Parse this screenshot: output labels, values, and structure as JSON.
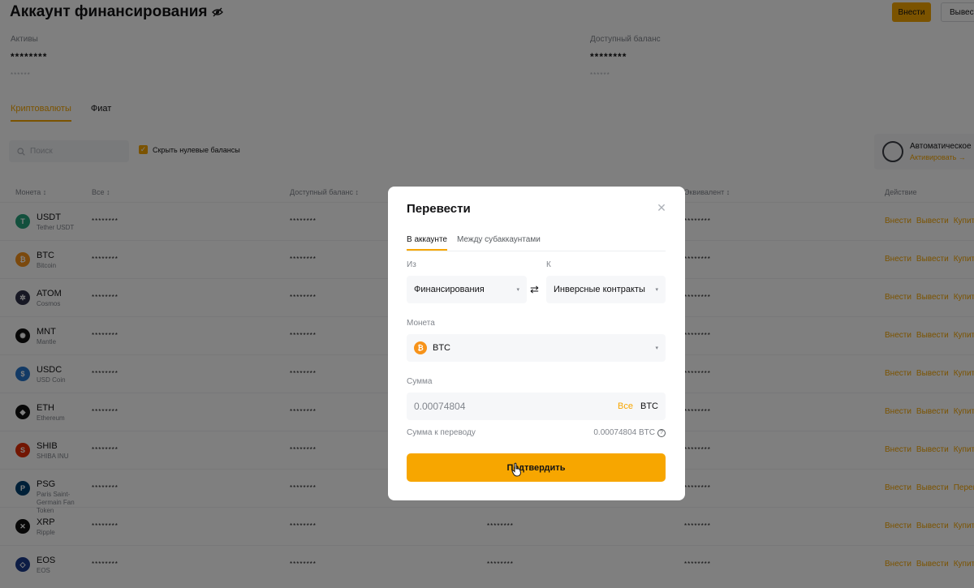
{
  "header": {
    "title": "Аккаунт финансирования",
    "deposit_label": "Внести",
    "withdraw_label": "Вывести"
  },
  "balances": {
    "assets_label": "Активы",
    "assets_value": "********",
    "assets_sub": "******",
    "available_label": "Доступный баланс",
    "available_value": "********",
    "available_sub": "******"
  },
  "page_tabs": [
    "Криптовалюты",
    "Фиат"
  ],
  "filters": {
    "search_placeholder": "Поиск",
    "hide_zero_label": "Скрыть нулевые балансы"
  },
  "auto_card": {
    "title": "Автоматическое",
    "link": "Активировать →"
  },
  "table": {
    "headers": [
      "Монета ↕",
      "Все ↕",
      "Доступный баланс ↕",
      "Эквивалент ↕",
      "Действие"
    ],
    "masked": "********",
    "rows": [
      {
        "symbol": "USDT",
        "name": "Tether USDT",
        "color": "#26a17b",
        "glyph": "T",
        "actions": [
          "Внести",
          "Вывести",
          "Купить"
        ]
      },
      {
        "symbol": "BTC",
        "name": "Bitcoin",
        "color": "#f7931a",
        "glyph": "₿",
        "actions": [
          "Внести",
          "Вывести",
          "Купить"
        ]
      },
      {
        "symbol": "ATOM",
        "name": "Cosmos",
        "color": "#2e3148",
        "glyph": "✲",
        "actions": [
          "Внести",
          "Вывести",
          "Купить"
        ]
      },
      {
        "symbol": "MNT",
        "name": "Mantle",
        "color": "#111111",
        "glyph": "✺",
        "actions": [
          "Внести",
          "Вывести",
          "Купить"
        ]
      },
      {
        "symbol": "USDC",
        "name": "USD Coin",
        "color": "#2775ca",
        "glyph": "$",
        "actions": [
          "Внести",
          "Вывести",
          "Купить"
        ]
      },
      {
        "symbol": "ETH",
        "name": "Ethereum",
        "color": "#111111",
        "glyph": "◆",
        "actions": [
          "Внести",
          "Вывести",
          "Купить"
        ]
      },
      {
        "symbol": "SHIB",
        "name": "SHIBA INU",
        "color": "#e42d04",
        "glyph": "S",
        "actions": [
          "Внести",
          "Вывести",
          "Купить"
        ]
      },
      {
        "symbol": "PSG",
        "name": "Paris Saint-Germain Fan Token",
        "color": "#004170",
        "glyph": "P",
        "actions": [
          "Внести",
          "Вывести",
          "Перевести"
        ]
      },
      {
        "symbol": "XRP",
        "name": "Ripple",
        "color": "#111111",
        "glyph": "✕",
        "actions": [
          "Внести",
          "Вывести",
          "Купить"
        ]
      },
      {
        "symbol": "EOS",
        "name": "EOS",
        "color": "#1a3a8a",
        "glyph": "◇",
        "actions": [
          "Внести",
          "Вывести",
          "Купить"
        ]
      }
    ]
  },
  "modal": {
    "title": "Перевести",
    "tabs": [
      "В аккаунте",
      "Между субаккаунтами"
    ],
    "from_label": "Из",
    "from_value": "Финансирования",
    "to_label": "К",
    "to_value": "Инверсные контракты",
    "coin_label": "Монета",
    "coin_value": "BTC",
    "amount_label": "Сумма",
    "amount_value": "0.00074804",
    "all_label": "Все",
    "amount_unit": "BTC",
    "transfer_sum_label": "Сумма к переводу",
    "transfer_sum_value": "0.00074804 BTC",
    "confirm_label": "Подтвердить"
  },
  "colors": {
    "accent": "#f7a600",
    "overlay": "rgba(0,0,0,0.5)"
  }
}
